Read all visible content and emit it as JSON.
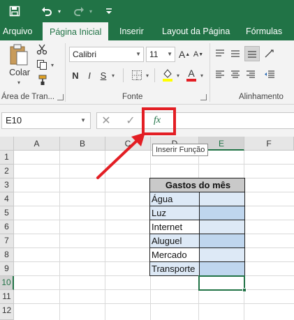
{
  "tabs": [
    {
      "label": "Arquivo"
    },
    {
      "label": "Página Inicial"
    },
    {
      "label": "Inserir"
    },
    {
      "label": "Layout da Página"
    },
    {
      "label": "Fórmulas"
    }
  ],
  "ribbon": {
    "paste_label": "Colar",
    "clipboard_group": "Área de Tran...",
    "font_name": "Calibri",
    "font_size": "11",
    "bold": "N",
    "italic": "I",
    "underline": "S",
    "font_group": "Fonte",
    "align_group": "Alinhamento"
  },
  "formula_bar": {
    "name_box": "E10",
    "fx_label": "fx",
    "tooltip": "Inserir Função"
  },
  "grid": {
    "columns": [
      "A",
      "B",
      "C",
      "D",
      "E",
      "F"
    ],
    "rows": [
      "1",
      "2",
      "3",
      "4",
      "5",
      "6",
      "7",
      "8",
      "9",
      "10",
      "11",
      "12"
    ],
    "selected_column": "E",
    "selected_row": "10",
    "table_header": "Gastos do mês",
    "items": [
      "Água",
      "Luz",
      "Internet",
      "Aluguel",
      "Mercado",
      "Transporte"
    ]
  },
  "colors": {
    "excel_green": "#217346",
    "highlight_red": "#e31e24",
    "table_header_bg": "#c9c9c9",
    "table_cell_bg": "#dde9f6"
  },
  "icons": [
    "save-icon",
    "undo-icon",
    "redo-icon",
    "customize-qat-icon",
    "paste-icon",
    "cut-icon",
    "copy-icon",
    "format-painter-icon",
    "increase-font-icon",
    "decrease-font-icon",
    "borders-icon",
    "fill-color-icon",
    "font-color-icon",
    "align-icon",
    "cancel-icon",
    "enter-icon",
    "insert-function-icon",
    "arrow-annotation"
  ]
}
